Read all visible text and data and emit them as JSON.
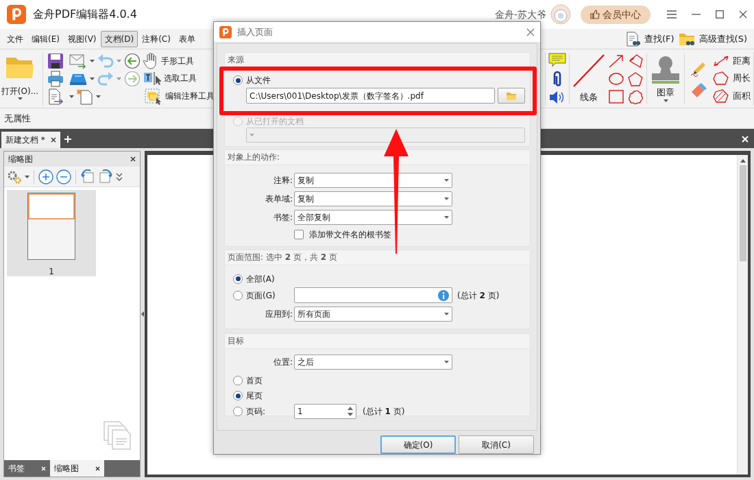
{
  "app": {
    "title": "金舟PDF编辑器4.0.4",
    "user": "金舟-苏大爷",
    "member_button": "会员中心"
  },
  "menu": [
    {
      "label": "文件",
      "selected": false
    },
    {
      "label": "编辑(E)",
      "selected": false
    },
    {
      "label": "视图(V)",
      "selected": false
    },
    {
      "label": "文档(D)",
      "selected": true
    },
    {
      "label": "注释(C)",
      "selected": false
    },
    {
      "label": "表单",
      "selected": false
    }
  ],
  "find_buttons": [
    "查找(F)",
    "高级查找(S)"
  ],
  "ribbon": {
    "open_button": "打开(O)...",
    "tools": [
      "手形工具",
      "选取工具",
      "编辑注释工具"
    ],
    "line_tool": "线条",
    "stamp_tool": "图章",
    "measure_tools": [
      "距离",
      "周长",
      "面积"
    ]
  },
  "properties_bar": "无属性",
  "document_tabs": [
    {
      "label": "新建文档 *",
      "selected": true
    }
  ],
  "side_panel": {
    "title": "缩略图",
    "pages": [
      {
        "label": "1",
        "selected": true
      }
    ],
    "tabs": [
      {
        "label": "书签",
        "selected": false
      },
      {
        "label": "缩略图",
        "selected": true
      }
    ]
  },
  "dialog": {
    "title": "插入页面",
    "source": {
      "title": "来源",
      "options": [
        {
          "label": "从文件",
          "kind": "file",
          "selected": true,
          "disabled": false,
          "path": "C:\\Users\\001\\Desktop\\发票（数字签名）.pdf"
        },
        {
          "label": "从已打开的文档",
          "kind": "document",
          "selected": false,
          "disabled": true
        }
      ]
    },
    "actions": {
      "title": "对象上的动作:",
      "fields": [
        {
          "label": "注释:",
          "value": "复制"
        },
        {
          "label": "表单域:",
          "value": "复制"
        },
        {
          "label": "书签:",
          "value": "全部复制"
        }
      ],
      "root_bookmark": {
        "label": "添加带文件名的根书签",
        "checked": false
      }
    },
    "page_range": {
      "title": "页面范围: 选中 **2** 页，共 **2** 页",
      "options": [
        {
          "label": "全部(A)",
          "kind": "plain",
          "selected": true
        },
        {
          "label": "页面(G)",
          "kind": "field",
          "selected": false,
          "total": "(总计 **2** 页)"
        }
      ],
      "apply_to": {
        "label": "应用到:",
        "value": "所有页面"
      }
    },
    "target": {
      "title": "目标",
      "position": {
        "label": "位置:",
        "value": "之后"
      },
      "options": [
        {
          "label": "首页",
          "kind": "plain",
          "selected": false
        },
        {
          "label": "尾页",
          "kind": "plain",
          "selected": true
        },
        {
          "label": "页码:",
          "kind": "number",
          "selected": false,
          "value": "1",
          "total": "(总计 **1** 页)"
        }
      ]
    },
    "buttons": [
      {
        "label": "确定(O)",
        "kind": "default"
      },
      {
        "label": "取消(C)",
        "kind": "normal"
      }
    ]
  }
}
